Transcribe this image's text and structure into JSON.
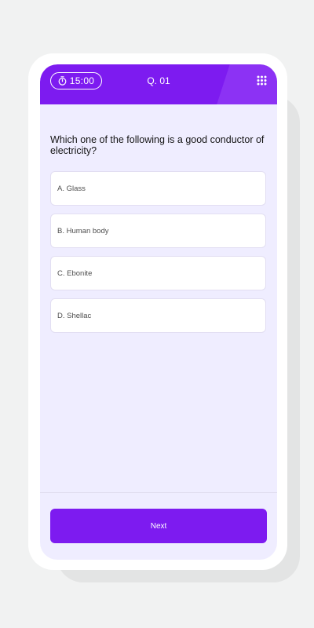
{
  "header": {
    "timer_text": "15:00",
    "timer_icon": "stopwatch-icon",
    "question_number": "Q. 01",
    "menu_icon": "grid-menu-icon"
  },
  "question": {
    "text": "Which one of the following is a good conductor of electricity?"
  },
  "options": [
    {
      "label": "A. Glass"
    },
    {
      "label": "B. Human body"
    },
    {
      "label": "C. Ebonite"
    },
    {
      "label": "D. Shellac"
    }
  ],
  "footer": {
    "next_label": "Next"
  },
  "colors": {
    "accent": "#7d1bf0",
    "screen_bg": "#efedff",
    "page_bg": "#f1f2f2"
  }
}
